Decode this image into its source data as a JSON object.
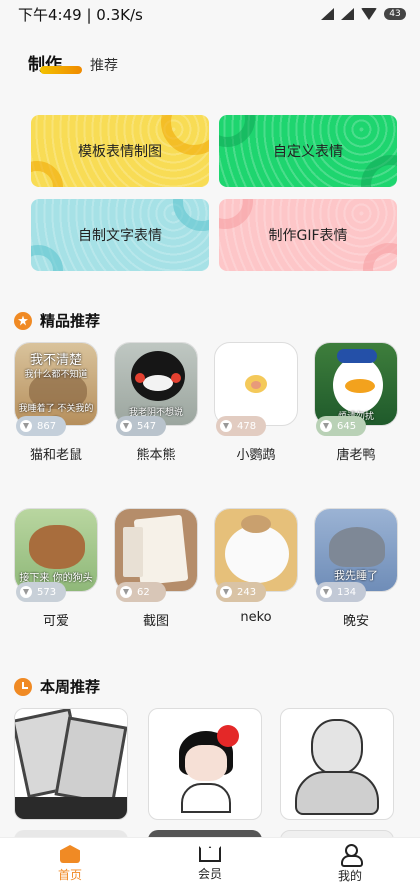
{
  "status_bar": {
    "time": "下午4:49",
    "speed": "0.3K/s",
    "battery": "43"
  },
  "top_tabs": {
    "made": "制作",
    "recommend": "推荐"
  },
  "feature_cards": [
    {
      "label": "模板表情制图"
    },
    {
      "label": "自定义表情"
    },
    {
      "label": "自制文字表情"
    },
    {
      "label": "制作GIF表情"
    }
  ],
  "featured": {
    "title": "精品推荐",
    "items": [
      {
        "name": "猫和老鼠",
        "count": "867",
        "caption_top": "我不清楚",
        "caption_mid": "我什么都不知道",
        "caption_bot": "我睡着了 不关我的事"
      },
      {
        "name": "熊本熊",
        "count": "547",
        "caption_top": "",
        "caption_mid": "",
        "caption_bot": "我老阴不想说"
      },
      {
        "name": "小鹦鹉",
        "count": "478",
        "caption_top": "",
        "caption_mid": "",
        "caption_bot": ""
      },
      {
        "name": "唐老鸭",
        "count": "645",
        "caption_top": "",
        "caption_mid": "",
        "caption_bot": "烦请勿扰"
      },
      {
        "name": "可爱",
        "count": "573",
        "caption_top": "",
        "caption_mid": "",
        "caption_bot": "接下来 你的狗头"
      },
      {
        "name": "截图",
        "count": "62",
        "caption_top": "",
        "caption_mid": "",
        "caption_bot": ""
      },
      {
        "name": "neko",
        "count": "243",
        "caption_top": "",
        "caption_mid": "",
        "caption_bot": ""
      },
      {
        "name": "晚安",
        "count": "134",
        "caption_top": "",
        "caption_mid": "",
        "caption_bot": "我先睡了"
      }
    ]
  },
  "weekly": {
    "title": "本周推荐"
  },
  "bottom_nav": {
    "home": "首页",
    "member": "会员",
    "mine": "我的"
  }
}
